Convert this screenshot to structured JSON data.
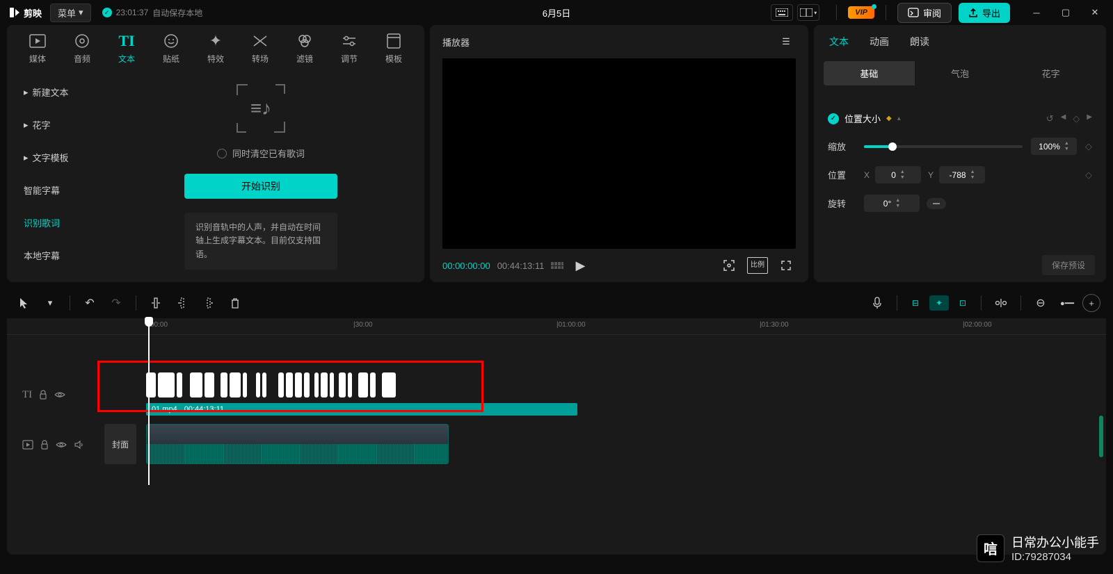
{
  "titlebar": {
    "app_name": "剪映",
    "menu_label": "菜单",
    "save_time": "23:01:37",
    "save_status": "自动保存本地",
    "document_title": "6月5日",
    "vip_label": "VIP",
    "review_label": "审阅",
    "export_label": "导出"
  },
  "nav": {
    "tabs": [
      {
        "label": "媒体"
      },
      {
        "label": "音频"
      },
      {
        "label": "文本"
      },
      {
        "label": "贴纸"
      },
      {
        "label": "特效"
      },
      {
        "label": "转场"
      },
      {
        "label": "滤镜"
      },
      {
        "label": "调节"
      },
      {
        "label": "模板"
      }
    ]
  },
  "sidebar": {
    "items": [
      {
        "label": "新建文本"
      },
      {
        "label": "花字"
      },
      {
        "label": "文字模板"
      },
      {
        "label": "智能字幕"
      },
      {
        "label": "识别歌词"
      },
      {
        "label": "本地字幕"
      }
    ]
  },
  "center": {
    "checkbox_label": "同时清空已有歌词",
    "primary_button": "开始识别",
    "description": "识别音轨中的人声，并自动在时间轴上生成字幕文本。目前仅支持国语。"
  },
  "preview": {
    "header": "播放器",
    "time_current": "00:00:00:00",
    "time_total": "00:44:13:11",
    "ratio_label": "比例"
  },
  "props": {
    "tabs": [
      {
        "label": "文本"
      },
      {
        "label": "动画"
      },
      {
        "label": "朗读"
      }
    ],
    "segments": [
      {
        "label": "基础"
      },
      {
        "label": "气泡"
      },
      {
        "label": "花字"
      }
    ],
    "section_title": "位置大小",
    "scale_label": "缩放",
    "scale_value": "100%",
    "position_label": "位置",
    "pos_x_label": "X",
    "pos_x_value": "0",
    "pos_y_label": "Y",
    "pos_y_value": "-788",
    "rotate_label": "旋转",
    "rotate_value": "0°",
    "save_preset": "保存预设"
  },
  "timeline": {
    "ruler": [
      "00:00",
      "|30:00",
      "|01:00:00",
      "|01:30:00",
      "|02:00:00"
    ],
    "cover_label": "封面",
    "clip_name": "01.mp4",
    "clip_duration": "00:44:13:11"
  },
  "watermark": {
    "name": "日常办公小能手",
    "id": "ID:79287034"
  }
}
